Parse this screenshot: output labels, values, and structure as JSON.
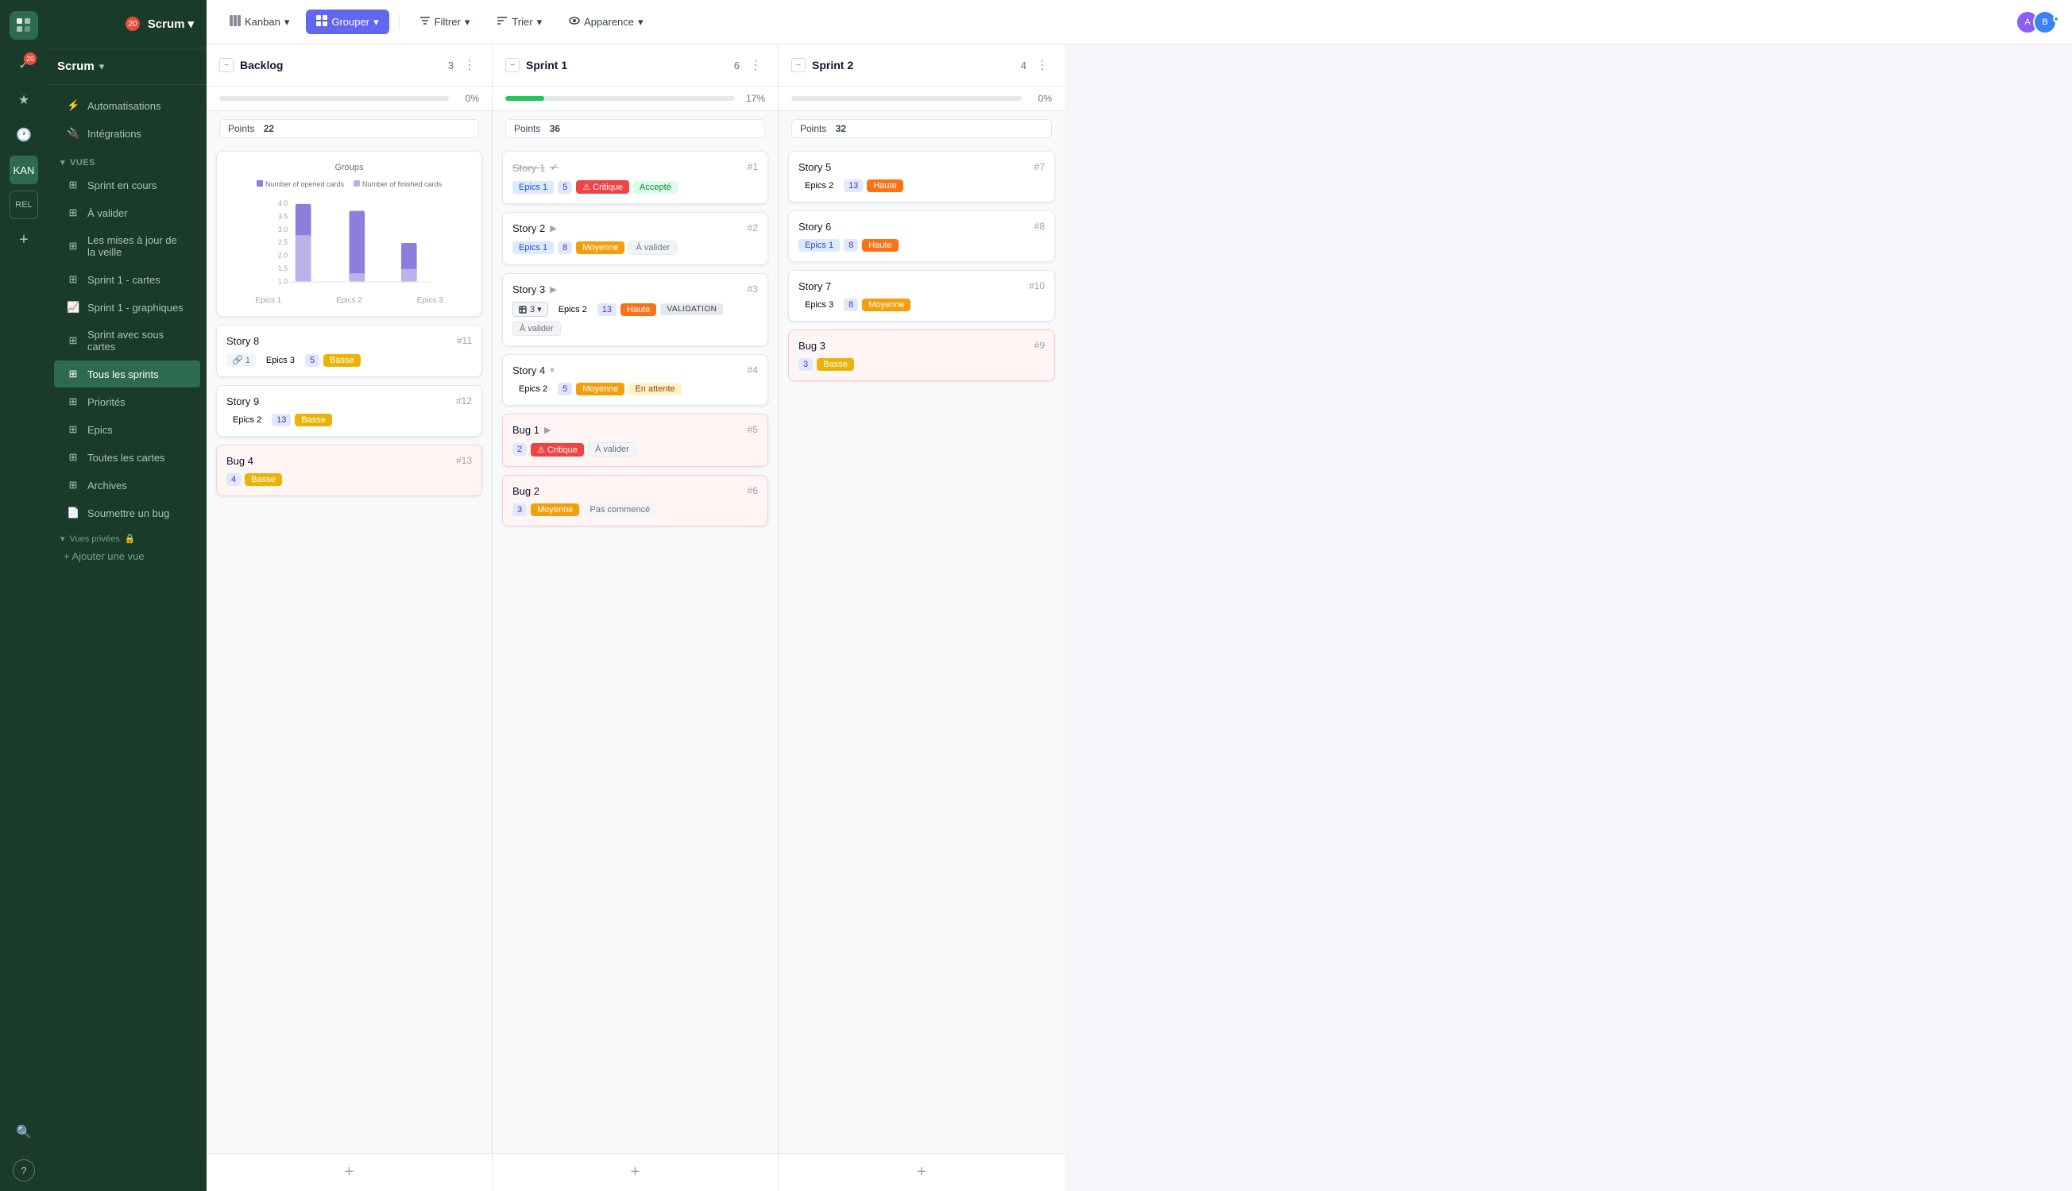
{
  "app": {
    "logo": "🔲",
    "title": "Scrum",
    "notifications": "20"
  },
  "sidebar": {
    "top_items": [
      {
        "id": "automatisations",
        "label": "Automatisations",
        "icon": "⚡"
      },
      {
        "id": "integrations",
        "label": "Intégrations",
        "icon": "🔌"
      }
    ],
    "vues_label": "Vues",
    "vues_items": [
      {
        "id": "sprint-en-cours",
        "label": "Sprint en cours",
        "icon": "▦"
      },
      {
        "id": "a-valider",
        "label": "À valider",
        "icon": "▦"
      },
      {
        "id": "mises-a-jour",
        "label": "Les mises à jour de la veille",
        "icon": "▦"
      },
      {
        "id": "sprint1-cartes",
        "label": "Sprint 1 - cartes",
        "icon": "▦"
      },
      {
        "id": "sprint1-graphiques",
        "label": "Sprint 1 - graphiques",
        "icon": "📈"
      },
      {
        "id": "sprint-sous-cartes",
        "label": "Sprint avec sous cartes",
        "icon": "▦"
      },
      {
        "id": "tous-les-sprints",
        "label": "Tous les sprints",
        "icon": "▦",
        "active": true
      },
      {
        "id": "priorites",
        "label": "Priorités",
        "icon": "▦"
      },
      {
        "id": "epics",
        "label": "Epics",
        "icon": "▦"
      },
      {
        "id": "toutes-les-cartes",
        "label": "Toutes les cartes",
        "icon": "▦"
      },
      {
        "id": "archives",
        "label": "Archives",
        "icon": "▦"
      },
      {
        "id": "soumettre-bug",
        "label": "Soumettre un bug",
        "icon": "📄"
      }
    ],
    "vues_privees_label": "Vues privées",
    "lock_icon": "🔒",
    "add_view_label": "+ Ajouter une vue",
    "help_label": "?"
  },
  "toolbar": {
    "kanban_label": "Kanban",
    "grouper_label": "Grouper",
    "filtrer_label": "Filtrer",
    "trier_label": "Trier",
    "apparence_label": "Apparence"
  },
  "columns": [
    {
      "id": "backlog",
      "title": "Backlog",
      "count": "3",
      "progress": 0,
      "progress_text": "0%",
      "points_label": "Points",
      "points_value": "22",
      "cards": [
        {
          "id": "chart",
          "type": "chart"
        },
        {
          "id": "story8",
          "title": "Story 8",
          "number": "#11",
          "type": "story",
          "tags": [
            {
              "type": "counter",
              "value": "1",
              "icon": "🔗"
            },
            {
              "type": "epics3",
              "label": "Epics 3"
            },
            {
              "type": "num",
              "value": "5"
            },
            {
              "type": "basse",
              "label": "Basse"
            }
          ]
        },
        {
          "id": "story9",
          "title": "Story 9",
          "number": "#12",
          "type": "story",
          "tags": [
            {
              "type": "epics2",
              "label": "Epics 2"
            },
            {
              "type": "num",
              "value": "13"
            },
            {
              "type": "basse",
              "label": "Basse"
            }
          ]
        },
        {
          "id": "bug4",
          "title": "Bug 4",
          "number": "#13",
          "type": "bug",
          "tags": [
            {
              "type": "num",
              "value": "4"
            },
            {
              "type": "basse",
              "label": "Basse"
            }
          ]
        }
      ]
    },
    {
      "id": "sprint1",
      "title": "Sprint 1",
      "count": "6",
      "progress": 17,
      "progress_text": "17%",
      "points_label": "Points",
      "points_value": "36",
      "cards": [
        {
          "id": "story1",
          "title": "Story 1",
          "number": "#1",
          "type": "story",
          "strikethrough": true,
          "check": true,
          "tags": [
            {
              "type": "epics1",
              "label": "Epics 1"
            },
            {
              "type": "num",
              "value": "5"
            },
            {
              "type": "critique",
              "label": "Critique"
            },
            {
              "type": "accepte",
              "label": "Accepté"
            }
          ]
        },
        {
          "id": "story2",
          "title": "Story 2",
          "number": "#2",
          "type": "story",
          "play": true,
          "tags": [
            {
              "type": "epics1",
              "label": "Epics 1"
            },
            {
              "type": "num",
              "value": "8"
            },
            {
              "type": "moyenne",
              "label": "Moyenne"
            },
            {
              "type": "a-valider",
              "label": "À valider"
            }
          ]
        },
        {
          "id": "story3",
          "title": "Story 3",
          "number": "#3",
          "type": "story",
          "play": true,
          "tags": [
            {
              "type": "dropdown",
              "value": "3"
            },
            {
              "type": "epics2",
              "label": "Epics 2"
            },
            {
              "type": "num",
              "value": "13"
            },
            {
              "type": "haute",
              "label": "Haute"
            },
            {
              "type": "validation",
              "label": "VALIDATION"
            },
            {
              "type": "a-valider",
              "label": "À valider"
            }
          ]
        },
        {
          "id": "story4",
          "title": "Story 4",
          "number": "#4",
          "type": "story",
          "pause": true,
          "tags": [
            {
              "type": "epics2",
              "label": "Epics 2"
            },
            {
              "type": "num",
              "value": "5"
            },
            {
              "type": "moyenne",
              "label": "Moyenne"
            },
            {
              "type": "en-attente",
              "label": "En attente"
            }
          ]
        },
        {
          "id": "bug1",
          "title": "Bug 1",
          "number": "#5",
          "type": "bug",
          "play": true,
          "tags": [
            {
              "type": "num",
              "value": "2"
            },
            {
              "type": "critique",
              "label": "Critique"
            },
            {
              "type": "a-valider",
              "label": "À valider"
            }
          ]
        },
        {
          "id": "bug2",
          "title": "Bug 2",
          "number": "#6",
          "type": "bug",
          "tags": [
            {
              "type": "num",
              "value": "3"
            },
            {
              "type": "moyenne",
              "label": "Moyenne"
            },
            {
              "type": "pas-commence",
              "label": "Pas commencé"
            }
          ]
        }
      ]
    },
    {
      "id": "sprint2",
      "title": "Sprint 2",
      "count": "4",
      "progress": 0,
      "progress_text": "0%",
      "points_label": "Points",
      "points_value": "32",
      "cards": [
        {
          "id": "story5",
          "title": "Story 5",
          "number": "#7",
          "type": "story",
          "tags": [
            {
              "type": "epics2",
              "label": "Epics 2"
            },
            {
              "type": "num",
              "value": "13"
            },
            {
              "type": "haute",
              "label": "Haute"
            }
          ]
        },
        {
          "id": "story6",
          "title": "Story 6",
          "number": "#8",
          "type": "story",
          "tags": [
            {
              "type": "epics1",
              "label": "Epics 1"
            },
            {
              "type": "num",
              "value": "8"
            },
            {
              "type": "haute",
              "label": "Haute"
            }
          ]
        },
        {
          "id": "story7",
          "title": "Story 7",
          "number": "#10",
          "type": "story",
          "tags": [
            {
              "type": "epics3",
              "label": "Epics 3"
            },
            {
              "type": "num",
              "value": "8"
            },
            {
              "type": "moyenne",
              "label": "Moyenne"
            }
          ]
        },
        {
          "id": "bug3",
          "title": "Bug 3",
          "number": "#9",
          "type": "bug",
          "tags": [
            {
              "type": "num",
              "value": "3"
            },
            {
              "type": "basse",
              "label": "Basse"
            }
          ]
        }
      ]
    }
  ],
  "chart": {
    "title": "Groups",
    "legend": [
      "Number of opened cards",
      "Number of finished cards"
    ],
    "labels": [
      "Epics 1",
      "Epics 2",
      "Epics 3"
    ],
    "bars": [
      {
        "open": 100,
        "closed": 40
      },
      {
        "open": 90,
        "closed": 15
      },
      {
        "open": 60,
        "closed": 20
      }
    ]
  }
}
